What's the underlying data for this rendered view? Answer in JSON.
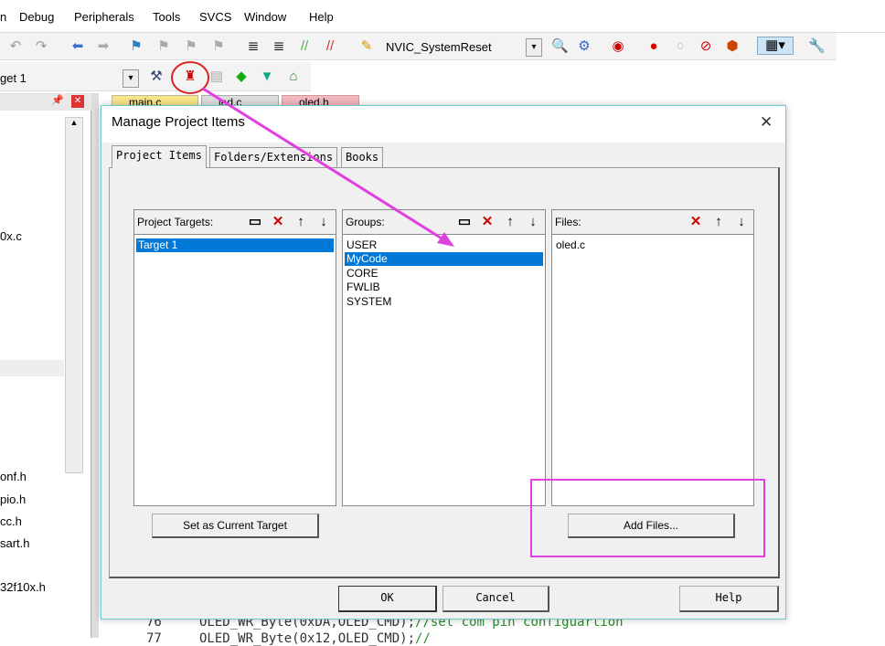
{
  "menu": [
    "n",
    "Debug",
    "Peripherals",
    "Tools",
    "SVCS",
    "Window",
    "Help"
  ],
  "toolbar": {
    "function_name": "NVIC_SystemReset",
    "target_select": "get 1"
  },
  "editor_tabs": [
    "main.c",
    "led.c",
    "oled.h"
  ],
  "left_panel": {
    "files": [
      "0x.c",
      "onf.h",
      "pio.h",
      "cc.h",
      "sart.h",
      "32f10x.h"
    ]
  },
  "dialog": {
    "title": "Manage Project Items",
    "close": "✕",
    "tabs": [
      "Project Items",
      "Folders/Extensions",
      "Books"
    ],
    "targets": {
      "label": "Project Targets:",
      "items": [
        "Target 1"
      ],
      "selected": 0
    },
    "groups": {
      "label": "Groups:",
      "items": [
        "USER",
        "MyCode",
        "CORE",
        "FWLIB",
        "SYSTEM"
      ],
      "selected": 1
    },
    "files": {
      "label": "Files:",
      "items": [
        "oled.c"
      ]
    },
    "set_current_label": "Set as Current Target",
    "add_files_label": "Add Files...",
    "ok_label": "OK",
    "cancel_label": "Cancel",
    "help_label": "Help"
  },
  "code": [
    {
      "line": "76",
      "text": "OLED_WR_Byte(0xDA,OLED_CMD);",
      "comment": "//set com pin configuartion"
    },
    {
      "line": "77",
      "text": "OLED_WR_Byte(0x12,OLED_CMD);",
      "comment": "//"
    }
  ],
  "colors": {
    "annotation": "#e040e0",
    "selection": "#0078d7"
  }
}
